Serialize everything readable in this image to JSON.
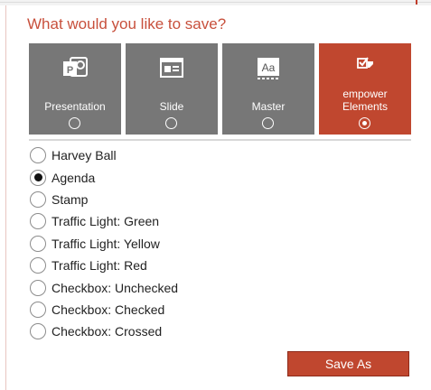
{
  "dialog": {
    "title": "What would you like to save?"
  },
  "tiles": [
    {
      "label": "Presentation",
      "icon": "powerpoint-icon",
      "selected": false
    },
    {
      "label": "Slide",
      "icon": "slide-layout-icon",
      "selected": false
    },
    {
      "label": "Master",
      "icon": "master-aa-icon",
      "selected": false,
      "icon_text": "Aa"
    },
    {
      "label_line1": "empower",
      "label_line2": "Elements",
      "icon": "element-check-icon",
      "selected": true
    }
  ],
  "options": [
    {
      "label": "Harvey Ball",
      "checked": false
    },
    {
      "label": "Agenda",
      "checked": true
    },
    {
      "label": "Stamp",
      "checked": false
    },
    {
      "label": "Traffic Light: Green",
      "checked": false
    },
    {
      "label": "Traffic Light: Yellow",
      "checked": false
    },
    {
      "label": "Traffic Light: Red",
      "checked": false
    },
    {
      "label": "Checkbox: Unchecked",
      "checked": false
    },
    {
      "label": "Checkbox: Checked",
      "checked": false
    },
    {
      "label": "Checkbox: Crossed",
      "checked": false
    }
  ],
  "actions": {
    "save_as_label": "Save As"
  },
  "colors": {
    "accent": "#c0472f",
    "tile_gray": "#777777",
    "title": "#c8503c"
  }
}
